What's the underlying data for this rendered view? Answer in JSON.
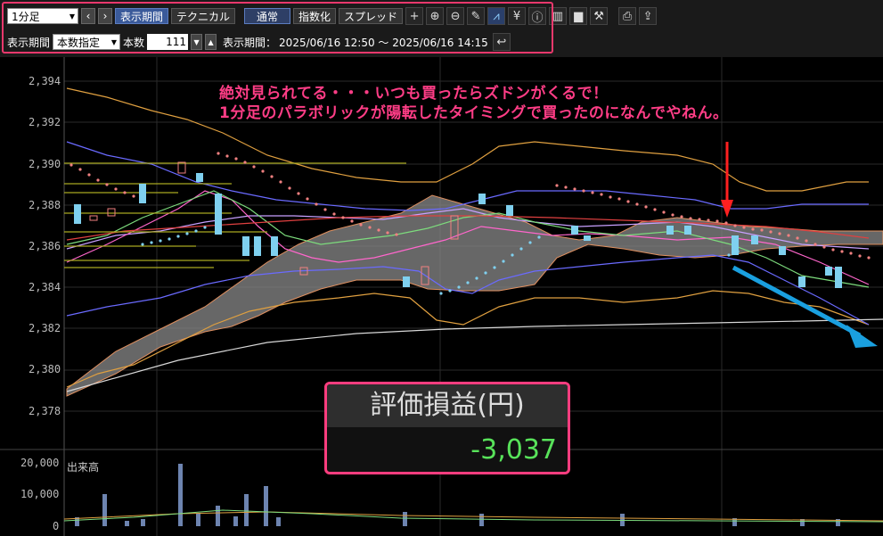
{
  "toolbar": {
    "timeframe": "1分足",
    "display_period": "表示期間",
    "technical": "テクニカル",
    "normal": "通常",
    "exponential": "指数化",
    "spread": "スプレッド",
    "period_label": "表示期間",
    "period_mode": "本数指定",
    "count_label": "本数",
    "count_value": "111",
    "range_label": "表示期間：",
    "range_value": "2025/06/16 12:50 ～ 2025/06/16 14:15"
  },
  "annotation": {
    "line1": "絶対見られてる・・・いつも買ったらズドンがくるで！",
    "line2": "1分足のパラボリックが陽転したタイミングで買ったのになんでやねん。"
  },
  "profit_loss": {
    "title": "評価損益(円)",
    "value": "-3,037"
  },
  "price_axis": [
    "2,394",
    "2,392",
    "2,390",
    "2,388",
    "2,386",
    "2,384",
    "2,382",
    "2,380",
    "2,378"
  ],
  "volume_axis": [
    "20,000",
    "10,000",
    "0"
  ],
  "volume_label": "出来高",
  "colors": {
    "accent": "#e8386c",
    "annotation": "#ff3d86",
    "gain_value": "#58e35a",
    "candle_down": "#7fd0ef",
    "parabolic": "#f08080",
    "cloud": "#8a8a8a"
  }
}
